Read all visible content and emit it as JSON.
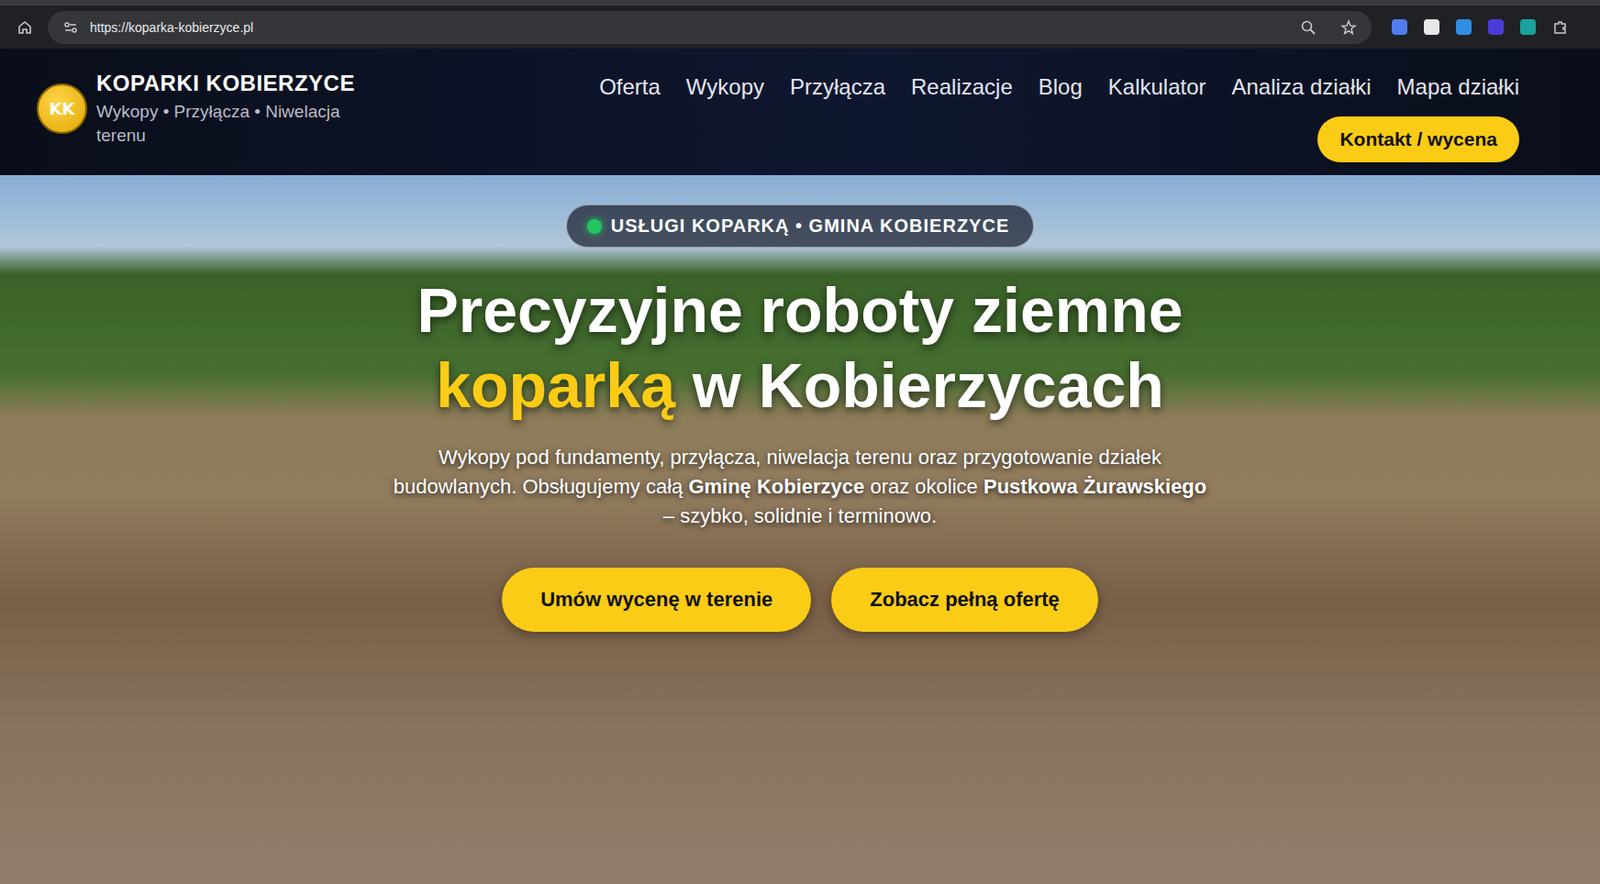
{
  "browser": {
    "url": "https://koparka-kobierzyce.pl"
  },
  "header": {
    "logo": "KK",
    "title": "KOPARKI KOBIERZYCE",
    "subtitle": "Wykopy • Przyłącza • Niwelacja terenu"
  },
  "nav": [
    "Oferta",
    "Wykopy",
    "Przyłącza",
    "Realizacje",
    "Blog",
    "Kalkulator",
    "Analiza działki",
    "Mapa działki"
  ],
  "cta": "Kontakt / wycena",
  "hero": {
    "badge": "USŁUGI KOPARKĄ • GMINA KOBIERZYCE",
    "title_line1": "Precyzyjne roboty ziemne",
    "title_line2": [
      {
        "text": "koparką",
        "highlight": true
      },
      {
        "text": " w Kobierzycach",
        "highlight": false
      }
    ],
    "description": [
      {
        "text": "Wykopy pod fundamenty, przyłącza, niwelacja terenu oraz przygotowanie działek budowlanych. Obsługujemy całą ",
        "bold": false
      },
      {
        "text": "Gminę Kobierzyce",
        "bold": true
      },
      {
        "text": " oraz okolice ",
        "bold": false
      },
      {
        "text": "Pustkowa Żurawskiego",
        "bold": true
      },
      {
        "text": " – szybko, solidnie i terminowo.",
        "bold": false
      }
    ],
    "buttons": [
      "Umów wycenę w terenie",
      "Zobacz pełną ofertę"
    ]
  }
}
